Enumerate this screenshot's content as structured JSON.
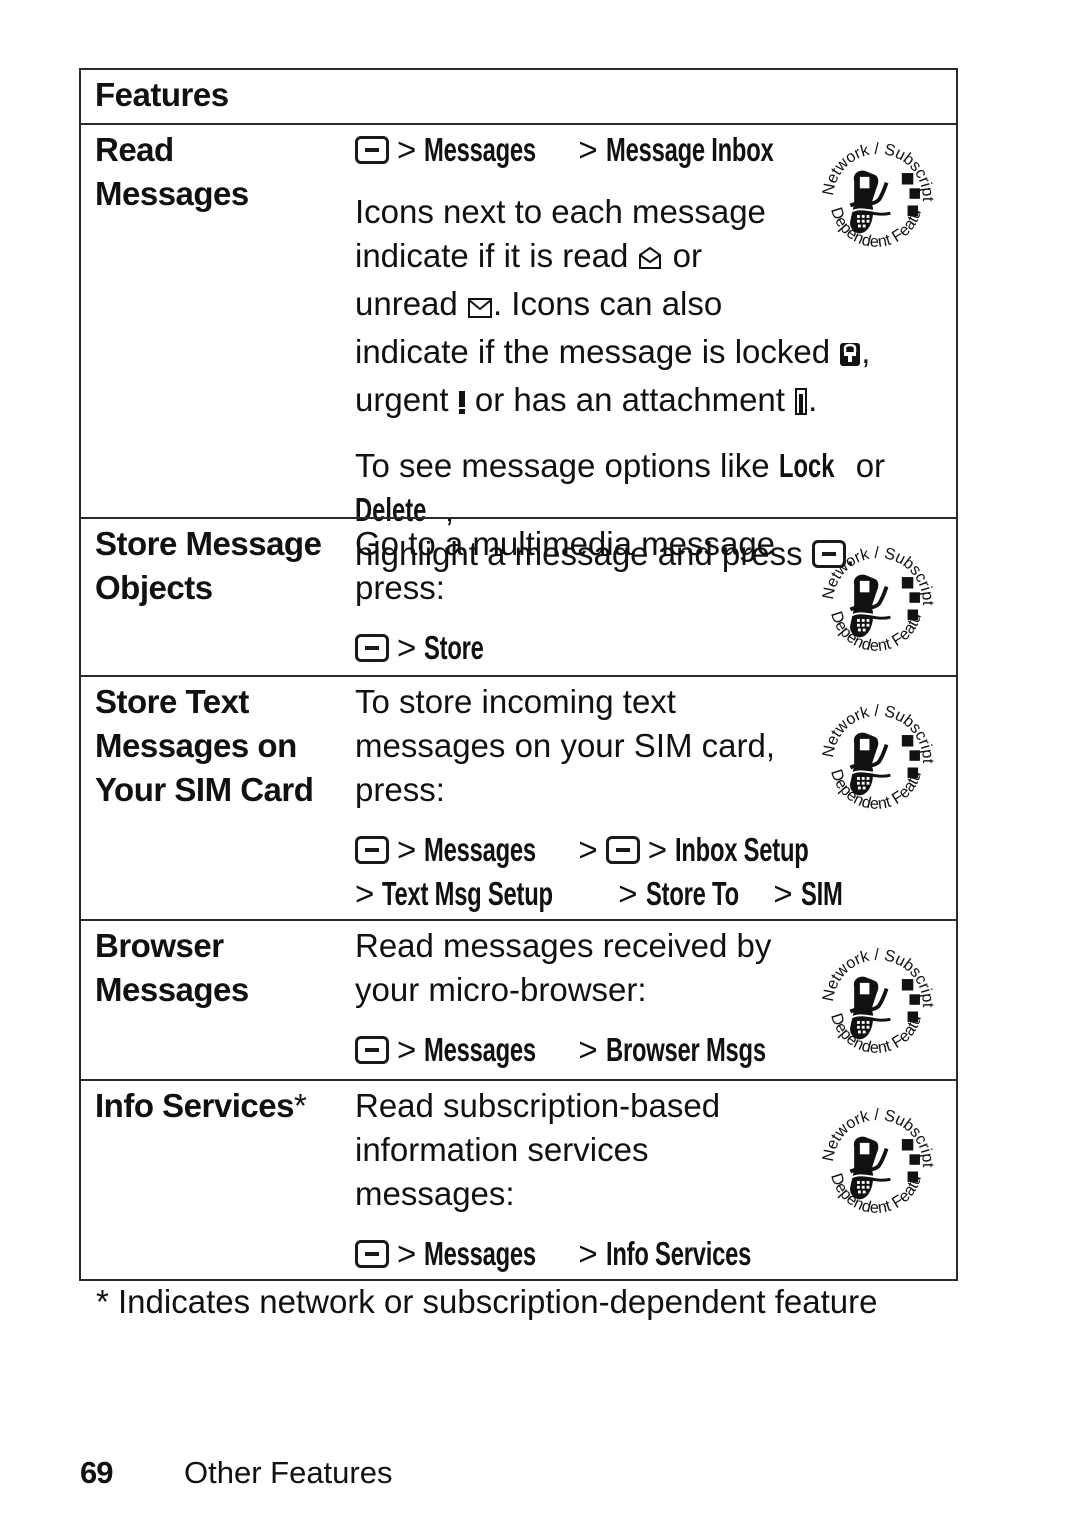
{
  "table": {
    "header": "Features",
    "rows": [
      {
        "name_lines": [
          "Read",
          "Messages"
        ],
        "path": [
          "Messages",
          "Message Inbox"
        ],
        "desc_lines": [
          "Icons next to each message",
          "indicate if it is read",
          "or",
          "unread",
          ". Icons can also",
          "indicate if the message is locked",
          ",",
          "urgent",
          "or has an attachment",
          "."
        ],
        "options_text": {
          "pre": "To see message options like",
          "lock": "Lock",
          "or": "or",
          "delete": "Delete",
          "comma": ",",
          "line2": "highlight a message and press",
          "end": "."
        },
        "badge": true
      },
      {
        "name_lines": [
          "Store Message",
          "Objects"
        ],
        "desc_lines": [
          "Go to a multimedia message",
          "press:"
        ],
        "path": [
          "Store"
        ],
        "badge": true
      },
      {
        "name_lines": [
          "Store Text",
          "Messages on",
          "Your SIM Card"
        ],
        "desc_lines": [
          "To store incoming text",
          "messages on your SIM card,",
          "press:"
        ],
        "path_line1": [
          "Messages",
          "Inbox Setup"
        ],
        "path_line2": [
          "Text Msg Setup",
          "Store To",
          "SIM"
        ],
        "badge": true
      },
      {
        "name_lines": [
          "Browser",
          "Messages"
        ],
        "desc_lines": [
          "Read messages received by",
          "your micro-browser:"
        ],
        "path": [
          "Messages",
          "Browser Msgs"
        ],
        "badge": true
      },
      {
        "name_lines": [
          "Info Services",
          "*"
        ],
        "desc_lines": [
          "Read subscription-based",
          "information services",
          "messages:"
        ],
        "path": [
          "Messages",
          "Info Services"
        ],
        "badge": true
      }
    ]
  },
  "separator": ">",
  "badge": {
    "top_text": "Network / Subscription",
    "bottom_text": "Dependent Feature"
  },
  "footnote": "* Indicates network or subscription-dependent feature",
  "footer": {
    "page_number": "69",
    "section": "Other Features"
  },
  "icons": {
    "menu_key": "menu-key-icon",
    "read": "envelope-open-icon",
    "unread": "envelope-closed-icon",
    "locked": "lock-icon",
    "urgent": "exclamation-icon",
    "attachment": "paperclip-icon",
    "badge": "network-subscription-dependent-feature-icon"
  }
}
